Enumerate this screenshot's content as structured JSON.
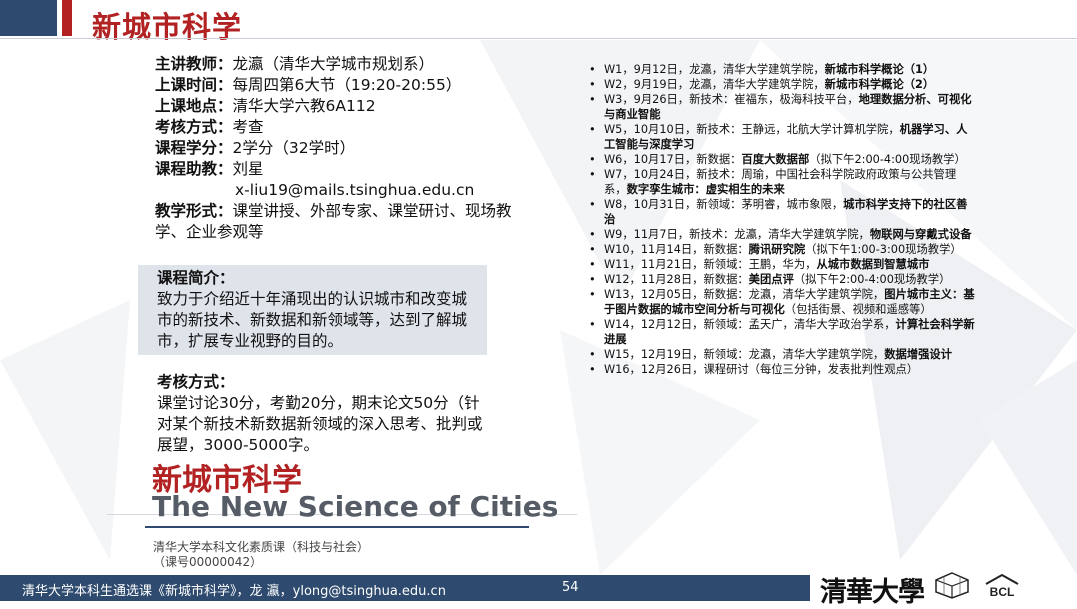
{
  "header": {
    "title": "新城市科学"
  },
  "info": [
    {
      "k": "主讲教师：",
      "v": "龙瀛（清华大学城市规划系）"
    },
    {
      "k": "上课时间：",
      "v": "每周四第6大节（19:20-20:55）"
    },
    {
      "k": "上课地点：",
      "v": "清华大学六教6A112"
    },
    {
      "k": "考核方式：",
      "v": "考查"
    },
    {
      "k": "课程学分：",
      "v": "2学分（32学时）"
    },
    {
      "k": "课程助教：",
      "v": "刘星"
    },
    {
      "k": "",
      "v": "x-liu19@mails.tsinghua.edu.cn"
    },
    {
      "k": "教学形式：",
      "v": "课堂讲授、外部专家、课堂研讨、现场教学、企业参观等"
    }
  ],
  "intro": {
    "label": "课程简介：",
    "text": "致力于介绍近十年涌现出的认识城市和改变城市的新技术、新数据和新领域等，达到了解城市，扩展专业视野的目的。"
  },
  "assessment": {
    "label": "考核方式：",
    "text": "课堂讨论30分，考勤20分，期末论文50分（针对某个新技术新数据新领域的深入思考、批判或展望，3000-5000字。"
  },
  "branding": {
    "title_cn": "新城市科学",
    "title_en": "The New Science of Cities",
    "sub1": "清华大学本科文化素质课（科技与社会）",
    "sub2": "（课号00000042）"
  },
  "schedule": [
    {
      "pre": "W1，9月12日，龙瀛，清华大学建筑学院，",
      "bold": "新城市科学概论（1）",
      "post": ""
    },
    {
      "pre": "W2，9月19日，龙瀛，清华大学建筑学院，",
      "bold": "新城市科学概论（2）",
      "post": ""
    },
    {
      "pre": "W3，9月26日，新技术：崔福东，极海科技平台，",
      "bold": "地理数据分析、可视化与商业智能",
      "post": ""
    },
    {
      "pre": "W5，10月10日，新技术：王静远，北航大学计算机学院，",
      "bold": "机器学习、人工智能与深度学习",
      "post": ""
    },
    {
      "pre": "W6，10月17日，新数据：",
      "bold": "百度大数据部",
      "post": "（拟下午2:00-4:00现场教学）"
    },
    {
      "pre": "W7，10月24日，新技术：周瑜，中国社会科学院政府政策与公共管理系，",
      "bold": "数字孪生城市：虚实相生的未来",
      "post": ""
    },
    {
      "pre": "W8，10月31日，新领域：茅明睿，城市象限，",
      "bold": "城市科学支持下的社区善治",
      "post": ""
    },
    {
      "pre": "W9，11月7日，新技术：龙瀛，清华大学建筑学院，",
      "bold": "物联网与穿戴式设备",
      "post": ""
    },
    {
      "pre": "W10，11月14日，新数据：",
      "bold": "腾讯研究院",
      "post": "（拟下午1:00-3:00现场教学）"
    },
    {
      "pre": "W11，11月21日，新领域：王鹏，华为，",
      "bold": "从城市数据到智慧城市",
      "post": ""
    },
    {
      "pre": "W12，11月28日，新数据：",
      "bold": "美团点评",
      "post": "（拟下午2:00-4:00现场教学）"
    },
    {
      "pre": "W13，12月05日，新数据：龙瀛，清华大学建筑学院，",
      "bold": "图片城市主义：基于图片数据的城市空间分析与可视化",
      "post": "（包括街景、视频和遥感等）"
    },
    {
      "pre": "W14，12月12日，新领域：孟天广，清华大学政治学系，",
      "bold": "计算社会科学新进展",
      "post": ""
    },
    {
      "pre": "W15，12月19日，新领域：龙瀛，清华大学建筑学院，",
      "bold": "数据增强设计",
      "post": ""
    },
    {
      "pre": "W16，12月26日，课程研讨（每位三分钟，发表批判性观点）",
      "bold": "",
      "post": ""
    }
  ],
  "footer": {
    "text": "清华大学本科生通选课《新城市科学》，龙 瀛，ylong@tsinghua.edu.cn",
    "page": "54",
    "logo_text": "清華大學",
    "lab_logo": "BCL"
  },
  "colors": {
    "accent": "#b22222",
    "navy": "#2e4a6e",
    "panel": "#dfe3ea"
  }
}
